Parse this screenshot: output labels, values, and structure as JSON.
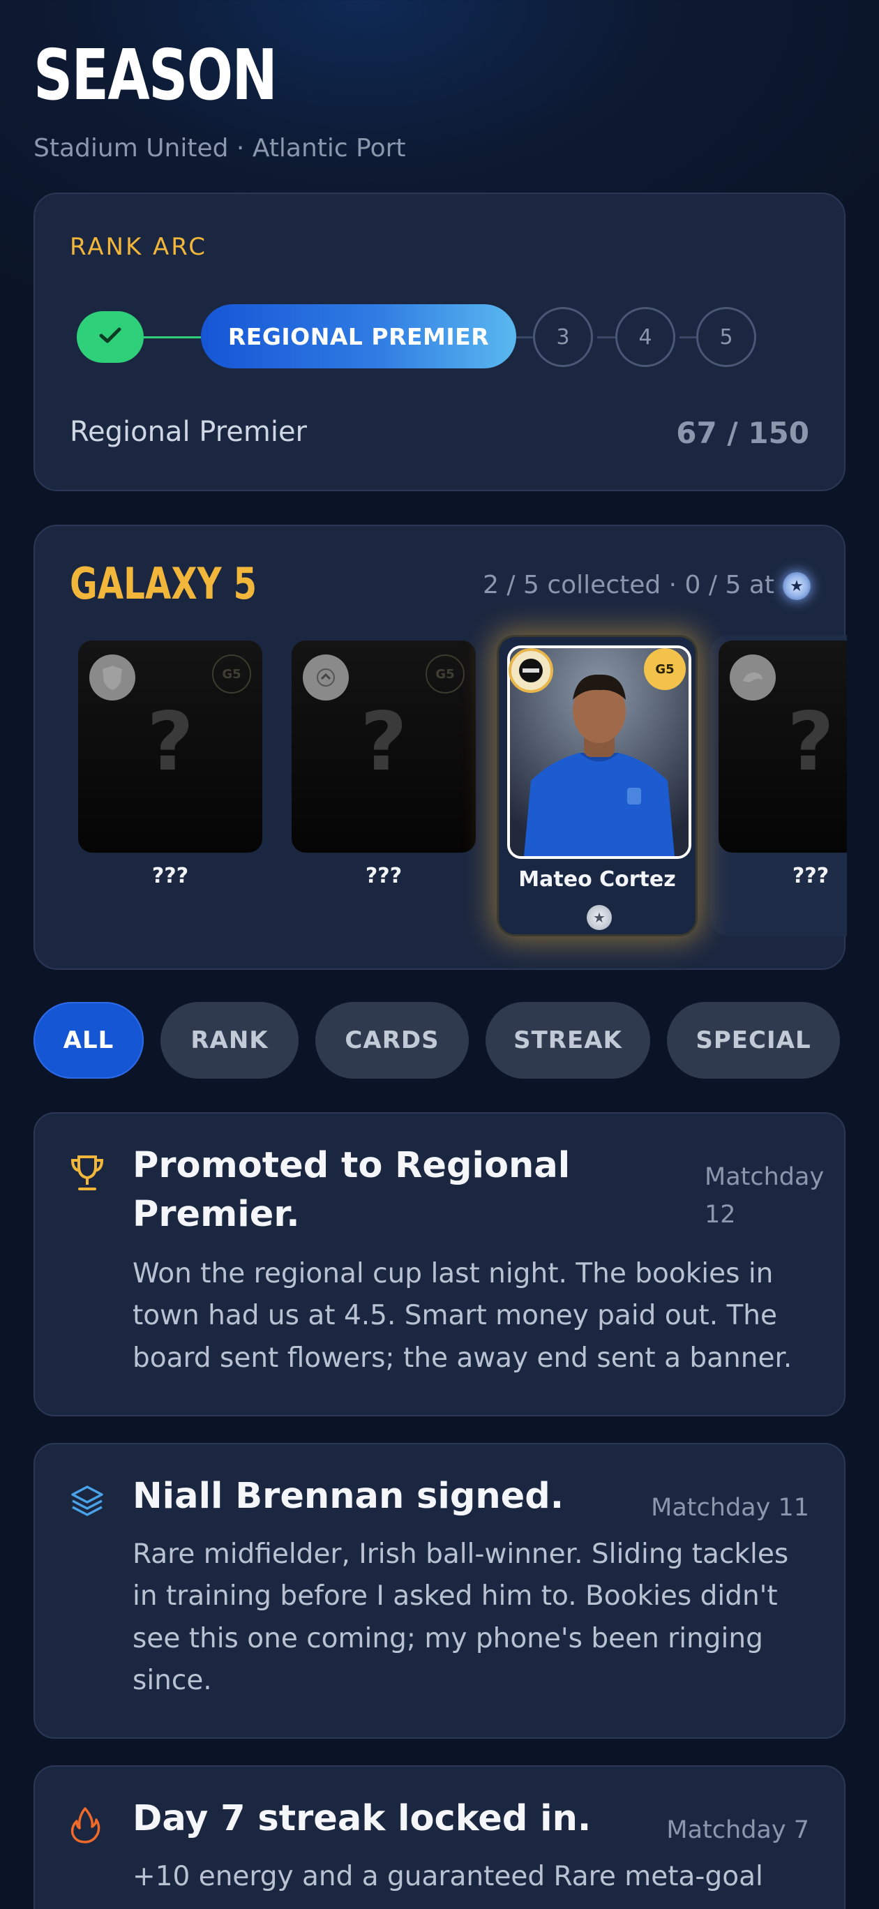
{
  "header": {
    "title": "SEASON",
    "subtitle": "Stadium United · Atlantic Port"
  },
  "rank_arc": {
    "label": "RANK ARC",
    "active_tier": "REGIONAL PREMIER",
    "upcoming_tiers": [
      "3",
      "4",
      "5"
    ],
    "current_name": "Regional Premier",
    "progress": "67 / 150"
  },
  "galaxy": {
    "title": "GALAXY 5",
    "meta": "2 / 5 collected · 0 / 5 at",
    "badge_text": "G5",
    "cards": [
      {
        "name": "???",
        "state": "locked"
      },
      {
        "name": "???",
        "state": "locked"
      },
      {
        "name": "Mateo Cortez",
        "state": "collected"
      },
      {
        "name": "???",
        "state": "locked"
      }
    ],
    "mystery_glyph": "?"
  },
  "filters": {
    "chips": [
      "ALL",
      "RANK",
      "CARDS",
      "STREAK",
      "SPECIAL"
    ],
    "active": "ALL"
  },
  "feed": [
    {
      "icon": "trophy-icon",
      "title": "Promoted to Regional Premier.",
      "title_line1": "Promoted to Regional",
      "title_line2": "Premier.",
      "date_line1": "Matchday",
      "date_line2": "12",
      "body_lines": [
        "Won the regional cup last night. The bookies in",
        "town had us at 4.5. Smart money paid out. The",
        "board sent flowers; the away end sent a banner."
      ]
    },
    {
      "icon": "layers-icon",
      "title": "Niall Brennan signed.",
      "date": "Matchday 11",
      "body_lines": [
        "Rare midfielder, Irish ball-winner. Sliding tackles",
        "in training before I asked him to. Bookies didn't",
        "see this one coming; my phone's been ringing",
        "since."
      ]
    },
    {
      "icon": "flame-icon",
      "title": "Day 7 streak locked in.",
      "date": "Matchday 7",
      "body_lines": [
        "+10 energy and a guaranteed Rare meta-goal"
      ]
    }
  ],
  "colors": {
    "accent_gold": "#f2b63b",
    "accent_blue": "#1556d4",
    "success_green": "#2fd07a",
    "card_bg": "#1b2740"
  }
}
